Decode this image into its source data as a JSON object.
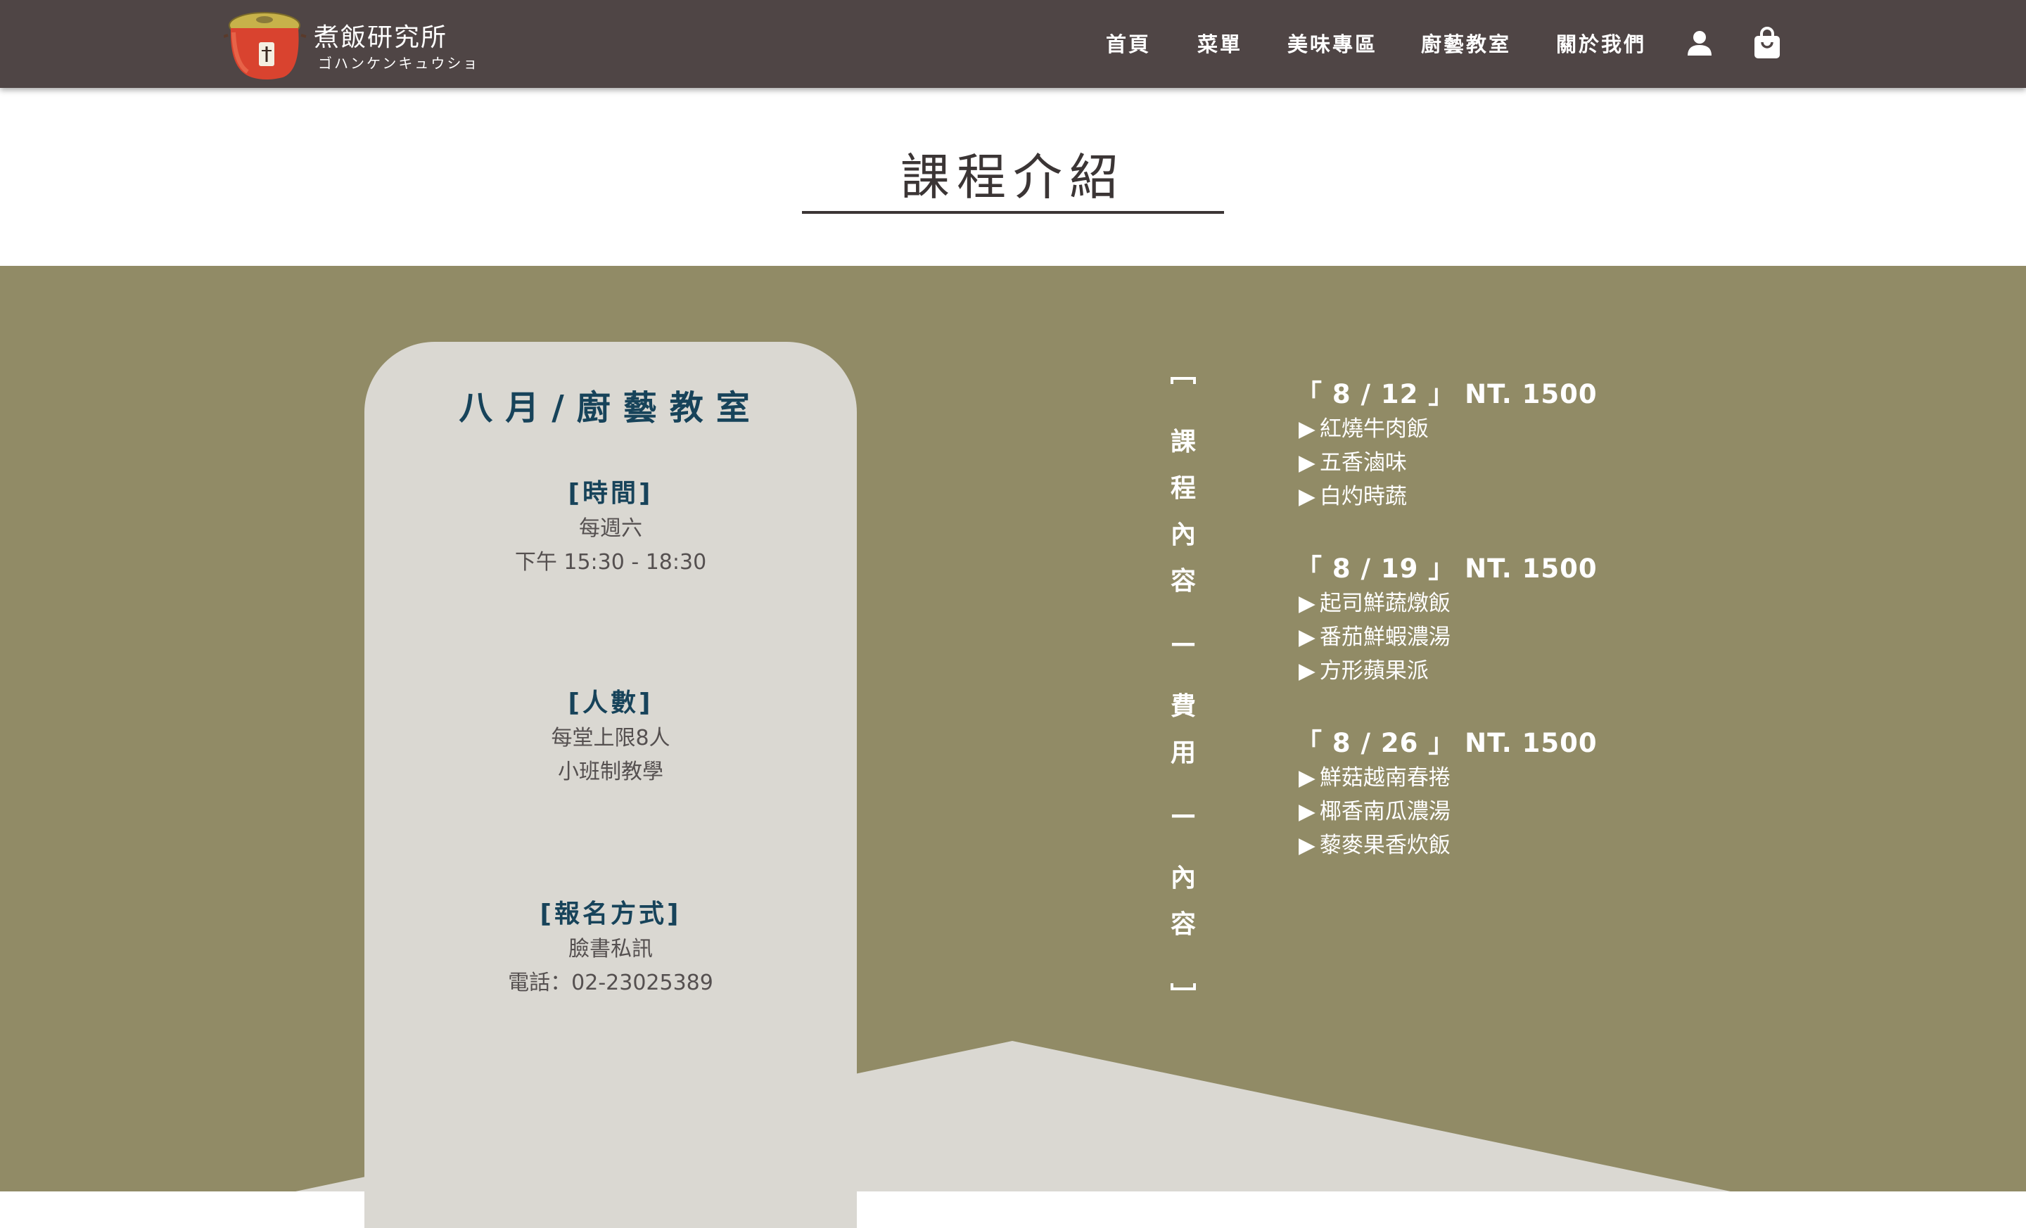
{
  "header": {
    "logo_name": "煮飯研究所",
    "logo_sub": "ゴハンケンキュウショ",
    "logo_label": "「",
    "nav": [
      "首頁",
      "菜單",
      "美味專區",
      "廚藝教室",
      "關於我們"
    ],
    "icons": {
      "account": "user-icon",
      "cart": "shopping-bag-icon"
    }
  },
  "section": {
    "title": "課程介紹"
  },
  "card": {
    "title": "八月/廚藝教室",
    "blocks": [
      {
        "head": "[時間]",
        "lines": [
          "每週六",
          "下午 15:30 - 18:30"
        ]
      },
      {
        "head": "[人數]",
        "lines": [
          "每堂上限8人",
          "小班制教學"
        ]
      },
      {
        "head": "[報名方式]",
        "lines": [
          "臉書私訊",
          "電話：02-23025389"
        ]
      }
    ]
  },
  "vertical_label": [
    "課",
    "程",
    "內",
    "容",
    "—",
    "費",
    "用",
    "—",
    "內",
    "容"
  ],
  "courses": [
    {
      "head": "「 8 / 12 」 NT. 1500",
      "items": [
        "紅燒牛肉飯",
        "五香滷味",
        "白灼時蔬"
      ]
    },
    {
      "head": "「 8 / 19 」 NT. 1500",
      "items": [
        "起司鮮蔬燉飯",
        "番茄鮮蝦濃湯",
        "方形蘋果派"
      ]
    },
    {
      "head": "「 8 / 26 」 NT. 1500",
      "items": [
        "鮮菇越南春捲",
        "椰香南瓜濃湯",
        "藜麥果香炊飯"
      ]
    }
  ],
  "list_marker": "▶",
  "colors": {
    "navbar": "#4f4545",
    "olive": "#918b66",
    "card": "#dad8d2",
    "accent_blue": "#17435a",
    "logo_pot": "#d9432f"
  }
}
